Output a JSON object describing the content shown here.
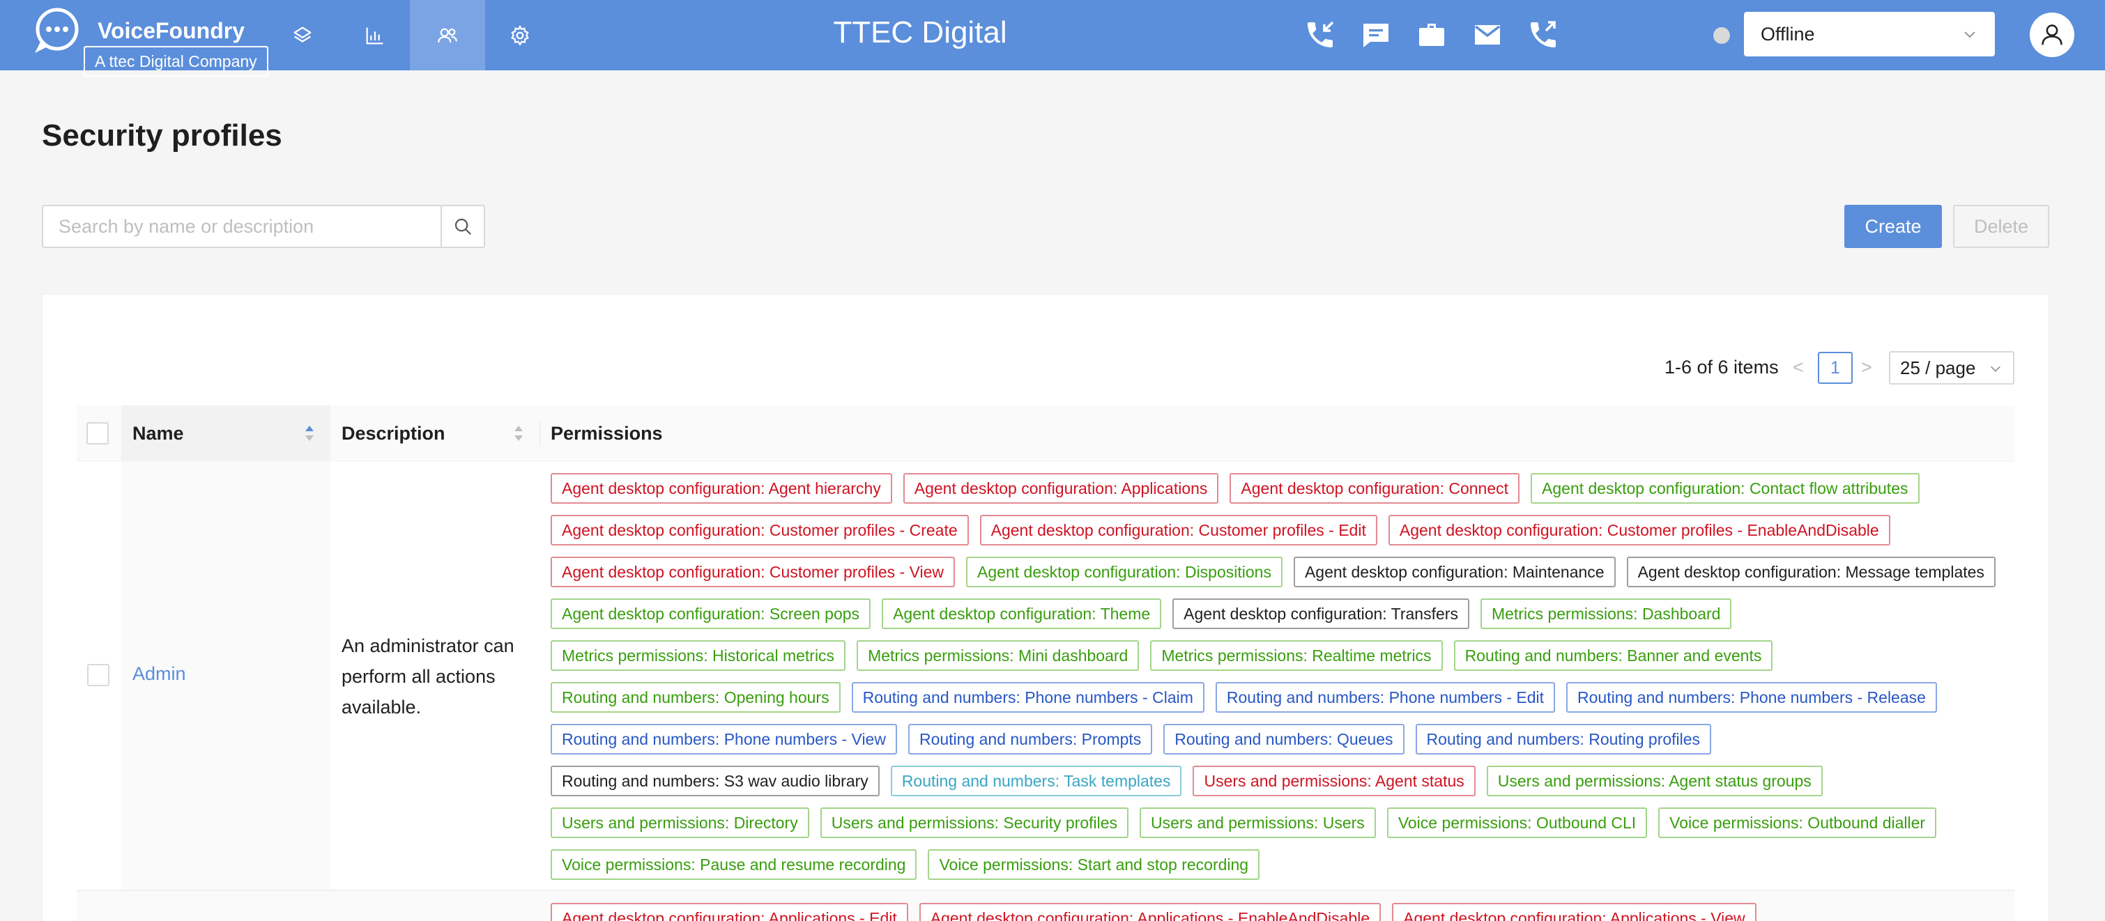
{
  "brand": {
    "name": "VoiceFoundry",
    "tagline": "A ttec Digital Company"
  },
  "header": {
    "title": "TTEC Digital",
    "status": {
      "selected": "Offline",
      "dot_color": "#d9d9d9"
    },
    "nav_icons": [
      "layers-icon",
      "bar-chart-icon",
      "users-icon",
      "gear-icon"
    ],
    "active_nav": "users-icon",
    "tool_icons": [
      "incoming-call-icon",
      "chat-icon",
      "briefcase-icon",
      "email-icon",
      "outgoing-call-icon"
    ]
  },
  "page": {
    "title": "Security profiles",
    "search_placeholder": "Search by name or description",
    "create_label": "Create",
    "delete_label": "Delete"
  },
  "pagination": {
    "total_text": "1-6 of 6 items",
    "current_page": "1",
    "page_size": "25 / page"
  },
  "table": {
    "columns": {
      "name": "Name",
      "description": "Description",
      "permissions": "Permissions"
    },
    "rows": [
      {
        "name": "Admin",
        "description": "An administrator can perform all actions available.",
        "permission_rows": [
          [
            {
              "label": "Agent desktop configuration: Agent hierarchy",
              "color": "red"
            },
            {
              "label": "Agent desktop configuration: Applications",
              "color": "red"
            },
            {
              "label": "Agent desktop configuration: Connect",
              "color": "red"
            },
            {
              "label": "Agent desktop configuration: Contact flow attributes",
              "color": "green"
            }
          ],
          [
            {
              "label": "Agent desktop configuration: Customer profiles - Create",
              "color": "red"
            },
            {
              "label": "Agent desktop configuration: Customer profiles - Edit",
              "color": "red"
            },
            {
              "label": "Agent desktop configuration: Customer profiles - EnableAndDisable",
              "color": "red"
            }
          ],
          [
            {
              "label": "Agent desktop configuration: Customer profiles - View",
              "color": "red"
            },
            {
              "label": "Agent desktop configuration: Dispositions",
              "color": "green"
            },
            {
              "label": "Agent desktop configuration: Maintenance",
              "color": "black"
            },
            {
              "label": "Agent desktop configuration: Message templates",
              "color": "black"
            }
          ],
          [
            {
              "label": "Agent desktop configuration: Screen pops",
              "color": "green"
            },
            {
              "label": "Agent desktop configuration: Theme",
              "color": "green"
            },
            {
              "label": "Agent desktop configuration: Transfers",
              "color": "black"
            },
            {
              "label": "Metrics permissions: Dashboard",
              "color": "green"
            }
          ],
          [
            {
              "label": "Metrics permissions: Historical metrics",
              "color": "green"
            },
            {
              "label": "Metrics permissions: Mini dashboard",
              "color": "green"
            },
            {
              "label": "Metrics permissions: Realtime metrics",
              "color": "green"
            },
            {
              "label": "Routing and numbers: Banner and events",
              "color": "green"
            }
          ],
          [
            {
              "label": "Routing and numbers: Opening hours",
              "color": "green"
            },
            {
              "label": "Routing and numbers: Phone numbers - Claim",
              "color": "blue"
            },
            {
              "label": "Routing and numbers: Phone numbers - Edit",
              "color": "blue"
            },
            {
              "label": "Routing and numbers: Phone numbers - Release",
              "color": "blue"
            }
          ],
          [
            {
              "label": "Routing and numbers: Phone numbers - View",
              "color": "blue"
            },
            {
              "label": "Routing and numbers: Prompts",
              "color": "blue"
            },
            {
              "label": "Routing and numbers: Queues",
              "color": "blue"
            },
            {
              "label": "Routing and numbers: Routing profiles",
              "color": "blue"
            }
          ],
          [
            {
              "label": "Routing and numbers: S3 wav audio library",
              "color": "black"
            },
            {
              "label": "Routing and numbers: Task templates",
              "color": "cyan"
            },
            {
              "label": "Users and permissions: Agent status",
              "color": "red"
            },
            {
              "label": "Users and permissions: Agent status groups",
              "color": "green"
            }
          ],
          [
            {
              "label": "Users and permissions: Directory",
              "color": "green"
            },
            {
              "label": "Users and permissions: Security profiles",
              "color": "green"
            },
            {
              "label": "Users and permissions: Users",
              "color": "green"
            },
            {
              "label": "Voice permissions: Outbound CLI",
              "color": "green"
            },
            {
              "label": "Voice permissions: Outbound dialler",
              "color": "green"
            }
          ],
          [
            {
              "label": "Voice permissions: Pause and resume recording",
              "color": "green"
            },
            {
              "label": "Voice permissions: Start and stop recording",
              "color": "green"
            }
          ]
        ]
      },
      {
        "name": "",
        "description": "",
        "permission_rows": [
          [
            {
              "label": "Agent desktop configuration: Applications - Edit",
              "color": "red"
            },
            {
              "label": "Agent desktop configuration: Applications - EnableAndDisable",
              "color": "red"
            },
            {
              "label": "Agent desktop configuration: Applications - View",
              "color": "red"
            }
          ]
        ]
      }
    ]
  }
}
